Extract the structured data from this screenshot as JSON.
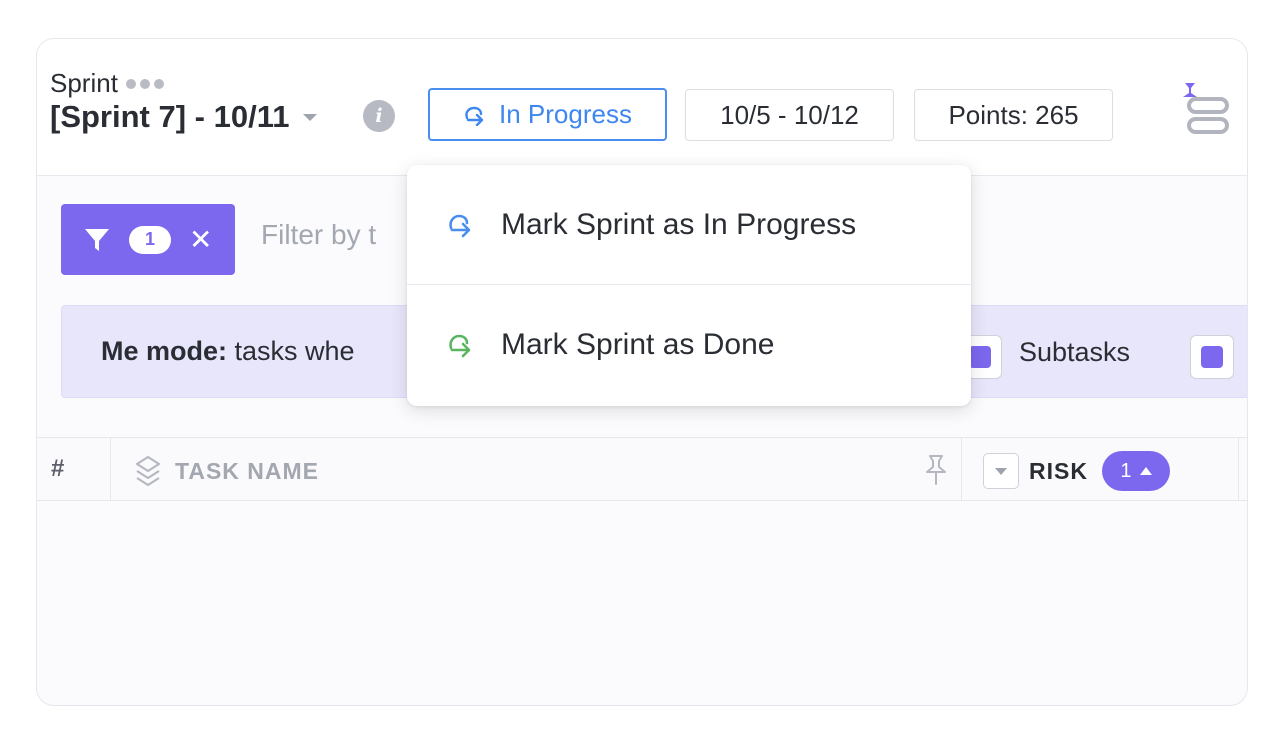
{
  "header": {
    "sprint_label": "Sprint",
    "sprint_name": "[Sprint 7] - 10/11",
    "status_button": "In Progress",
    "dates": "10/5 - 10/12",
    "points": "Points: 265"
  },
  "filter": {
    "count": "1",
    "placeholder_visible": "Filter by t"
  },
  "me_mode": {
    "label": "Me mode:",
    "text_visible": " tasks whe",
    "subtasks_label": "Subtasks"
  },
  "table": {
    "columns": {
      "hash": "#",
      "task_name": "TASK NAME",
      "risk": "RISK"
    },
    "sort_badge": "1"
  },
  "dropdown": {
    "items": [
      {
        "label": "Mark Sprint as In Progress",
        "icon": "progress-arrow-icon",
        "color": "#4a8ef0"
      },
      {
        "label": "Mark Sprint as Done",
        "icon": "done-arrow-icon",
        "color": "#5bb560"
      }
    ]
  },
  "colors": {
    "accent": "#7b68ee",
    "status_blue": "#4a8ef0",
    "done_green": "#5bb560"
  }
}
